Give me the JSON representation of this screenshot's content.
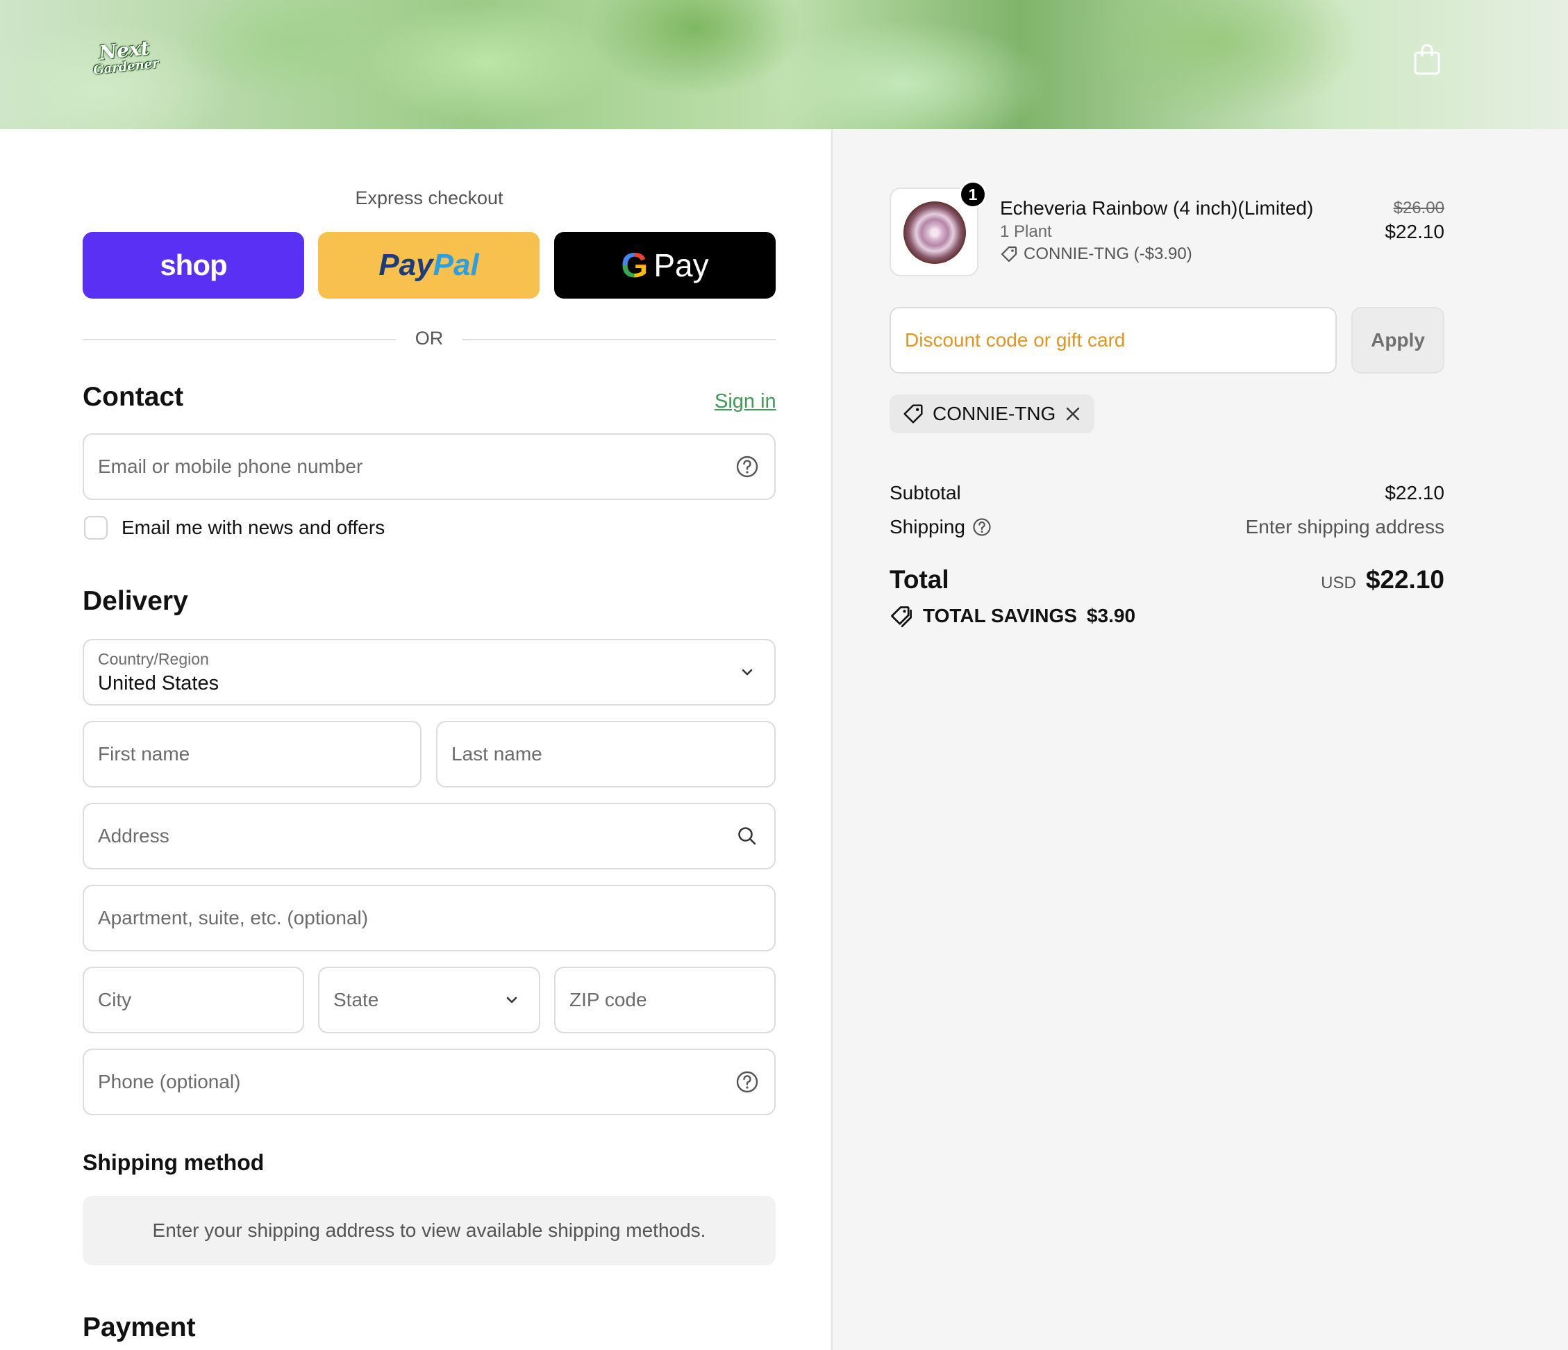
{
  "header": {
    "logo_line1": "Next",
    "logo_line2": "Gardener",
    "cart_icon": "shopping-bag-icon"
  },
  "express": {
    "title": "Express checkout",
    "shop_label": "shop",
    "paypal_label_1": "Pay",
    "paypal_label_2": "Pal",
    "gpay_g": "G",
    "gpay_label": "Pay",
    "or_label": "OR"
  },
  "contact": {
    "heading": "Contact",
    "sign_in": "Sign in",
    "email_placeholder": "Email or mobile phone number",
    "news_label": "Email me with news and offers"
  },
  "delivery": {
    "heading": "Delivery",
    "country_label": "Country/Region",
    "country_value": "United States",
    "first_name": "First name",
    "last_name": "Last name",
    "address": "Address",
    "apartment": "Apartment, suite, etc. (optional)",
    "city": "City",
    "state": "State",
    "zip": "ZIP code",
    "phone": "Phone (optional)"
  },
  "shipping_method": {
    "heading": "Shipping method",
    "note": "Enter your shipping address to view available shipping methods."
  },
  "payment": {
    "heading": "Payment"
  },
  "summary": {
    "item": {
      "quantity": "1",
      "title": "Echeveria Rainbow (4 inch)(Limited)",
      "variant": "1 Plant",
      "discount": "CONNIE-TNG (-$3.90)",
      "original_price": "$26.00",
      "price": "$22.10"
    },
    "discount_placeholder": "Discount code or gift card",
    "apply_label": "Apply",
    "applied_code": "CONNIE-TNG",
    "subtotal_label": "Subtotal",
    "subtotal_value": "$22.10",
    "shipping_label": "Shipping",
    "shipping_value": "Enter shipping address",
    "total_label": "Total",
    "total_currency": "USD",
    "total_value": "$22.10",
    "savings_label": "TOTAL SAVINGS",
    "savings_value": "$3.90"
  },
  "colors": {
    "shop": "#5a31f4",
    "paypal": "#f8c14d",
    "gpay": "#000000",
    "link": "#3f9a56",
    "discount_placeholder": "#e0951f"
  }
}
